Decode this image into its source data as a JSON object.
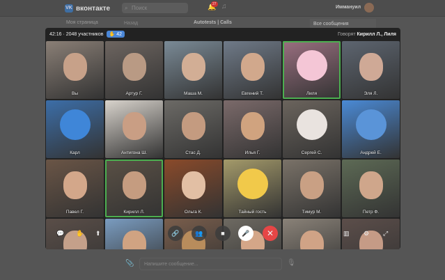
{
  "topbar": {
    "logo": "вконтакте",
    "search_placeholder": "Поиск",
    "notifications": "27",
    "user": "Иммануил"
  },
  "sidebar": {
    "my_page": "Моя страница"
  },
  "chat": {
    "back": "Назад",
    "title": "Autotests | Calls",
    "all_messages": "Все сообщения",
    "composer_placeholder": "Напишите сообщение..."
  },
  "call": {
    "info": "42:16 · 2048 участников",
    "raised_hands": "42",
    "speaking_label": "Говорят",
    "speaking_names": "Кирилл Л., Лиля"
  },
  "participants": [
    {
      "name": "Вы",
      "bg": "#8a7f76",
      "face": "#c7a189"
    },
    {
      "name": "Артур Г.",
      "bg": "#6d6560",
      "face": "#b99a84"
    },
    {
      "name": "Маша М.",
      "bg": "#7a8a96",
      "face": "#d2ae95"
    },
    {
      "name": "Евгений Т.",
      "bg": "#6f7a88",
      "face": "#d1a88c"
    },
    {
      "name": "Лиля",
      "bg": "#9a6f80",
      "avatar": "#f4c6d6",
      "speaking": true
    },
    {
      "name": "Эля Л.",
      "bg": "#5d6570",
      "face": "#cfa996"
    },
    {
      "name": "Карл",
      "bg": "#3c6ea8",
      "avatar": "#3f86d8"
    },
    {
      "name": "Антигона Ш.",
      "bg": "#d8d3cc",
      "face": "#c99e84"
    },
    {
      "name": "Стас Д.",
      "bg": "#6c6a66",
      "face": "#c49b80"
    },
    {
      "name": "Илья Г.",
      "bg": "#7b6a6a",
      "face": "#d0a37f"
    },
    {
      "name": "Сергей С.",
      "bg": "#6b645d",
      "avatar": "#e9e3df"
    },
    {
      "name": "Андрей Е.",
      "bg": "#4a8ad6",
      "avatar": "#5a94d8"
    },
    {
      "name": "Павел Г.",
      "bg": "#6a5546",
      "face": "#d3a78a"
    },
    {
      "name": "Кирилл Л.",
      "bg": "#5a5045",
      "face": "#c59c80",
      "speaking": true
    },
    {
      "name": "Ольга К.",
      "bg": "#8a4a2a",
      "face": "#e2bfa4"
    },
    {
      "name": "Тайный гость",
      "bg": "#a49a6a",
      "avatar": "#f1c94a"
    },
    {
      "name": "Тимур М.",
      "bg": "#7a7268",
      "face": "#c9a084"
    },
    {
      "name": "Петр Ф.",
      "bg": "#5d6a55",
      "face": "#cfa68b"
    },
    {
      "name": "",
      "bg": "#5a4e48",
      "face": "#c4a08a"
    },
    {
      "name": "",
      "bg": "#7a9cc0",
      "face": "#d0a382"
    },
    {
      "name": "",
      "bg": "#7a5e4c",
      "face": "#b88c5c"
    },
    {
      "name": "",
      "bg": "#6e6a62",
      "face": "#d4a688"
    },
    {
      "name": "",
      "bg": "#8a8278",
      "face": "#d0a386"
    },
    {
      "name": "",
      "bg": "#5c4e4a",
      "face": "#c59b86"
    }
  ],
  "colors": {
    "accent": "#4a86d6",
    "end_call": "#e64646",
    "speaking": "#4caf50"
  }
}
